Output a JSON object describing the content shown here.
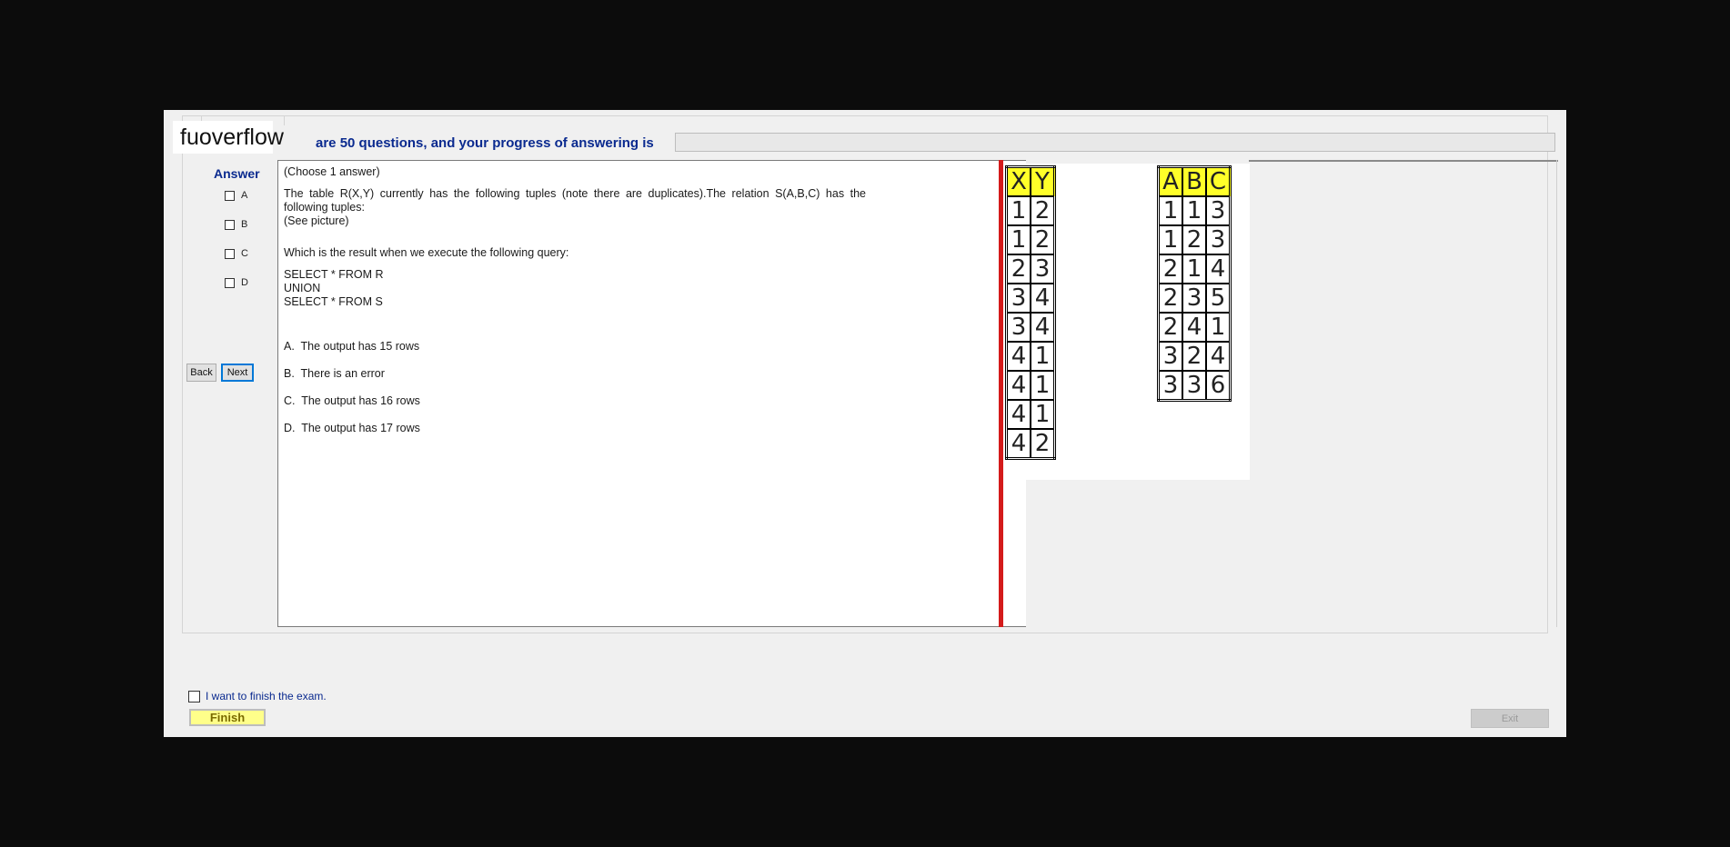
{
  "header": {
    "logo": "fuoverflow",
    "progress_text": "are 50 questions, and your progress of answering is"
  },
  "answer_panel": {
    "title": "Answer",
    "options": [
      "A",
      "B",
      "C",
      "D"
    ],
    "back_label": "Back",
    "next_label": "Next"
  },
  "question": {
    "instruction": "(Choose 1 answer)",
    "body": "The table R(X,Y) currently has the following tuples (note there are duplicates).The relation S(A,B,C) has the following tuples:",
    "see_picture": "(See picture)",
    "prompt": "Which is the result when we execute the following query:",
    "sql": [
      "SELECT * FROM R",
      "UNION",
      "SELECT * FROM S"
    ],
    "choices": [
      "A.  The output has 15 rows",
      "B.  There is an error",
      "C.  The output has 16 rows",
      "D.  The output has 17 rows"
    ]
  },
  "picture": {
    "table_r": {
      "headers": [
        "X",
        "Y"
      ],
      "rows": [
        [
          "1",
          "2"
        ],
        [
          "1",
          "2"
        ],
        [
          "2",
          "3"
        ],
        [
          "3",
          "4"
        ],
        [
          "3",
          "4"
        ],
        [
          "4",
          "1"
        ],
        [
          "4",
          "1"
        ],
        [
          "4",
          "1"
        ],
        [
          "4",
          "2"
        ]
      ]
    },
    "table_s": {
      "headers": [
        "A",
        "B",
        "C"
      ],
      "rows": [
        [
          "1",
          "1",
          "3"
        ],
        [
          "1",
          "2",
          "3"
        ],
        [
          "2",
          "1",
          "4"
        ],
        [
          "2",
          "3",
          "5"
        ],
        [
          "2",
          "4",
          "1"
        ],
        [
          "3",
          "2",
          "4"
        ],
        [
          "3",
          "3",
          "6"
        ]
      ]
    }
  },
  "footer": {
    "finish_checkbox_label": "I want to finish the exam.",
    "finish_label": "Finish",
    "exit_label": "Exit"
  }
}
